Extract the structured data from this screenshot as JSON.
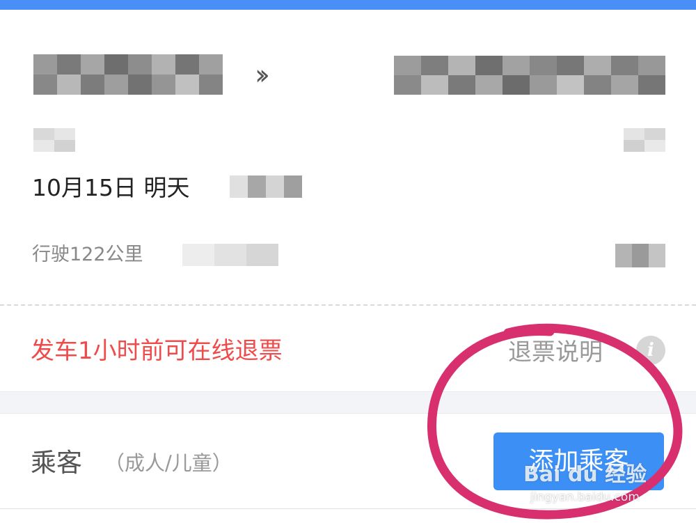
{
  "header": {
    "accent_color": "#4a8ef7"
  },
  "route": {
    "separator_icon": "double-chevron-right-icon",
    "origin_name": "",
    "destination_name": ""
  },
  "trip": {
    "date": "10月15日 明天",
    "distance": "行驶122公里"
  },
  "refund": {
    "note": "发车1小时前可在线退票",
    "note_color": "#ef4b4b",
    "link_label": "退票说明",
    "info_icon": "info-icon",
    "info_glyph": "i"
  },
  "passenger": {
    "label": "乘客",
    "hint": "（成人/儿童）",
    "add_button_label": "添加乘客",
    "button_color": "#3b8ff5"
  },
  "annotation": {
    "circle_color": "#d8306f"
  },
  "watermark": {
    "logo": "Bai du 经验",
    "url": "jingyan.baidu.com"
  }
}
